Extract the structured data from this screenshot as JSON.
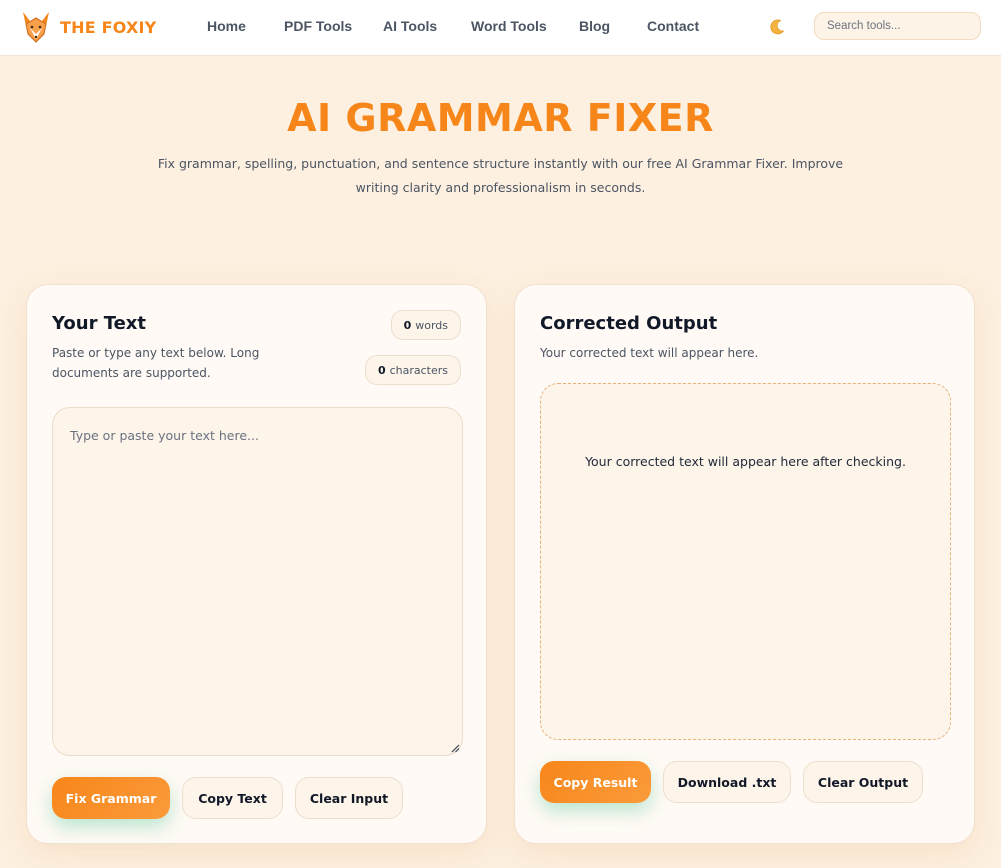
{
  "brand": {
    "name": "THE FOXIY",
    "color": "#f7861a"
  },
  "nav": {
    "items": [
      {
        "label": "Home"
      },
      {
        "label": "PDF Tools"
      },
      {
        "label": "AI Tools"
      },
      {
        "label": "Word Tools"
      },
      {
        "label": "Blog"
      },
      {
        "label": "Contact"
      }
    ],
    "theme_toggle_icon": "moon-icon"
  },
  "search": {
    "placeholder": "Search tools..."
  },
  "hero": {
    "title": "AI GRAMMAR FIXER",
    "subtitle": "Fix grammar, spelling, punctuation, and sentence structure instantly with our free AI Grammar Fixer. Improve writing clarity and professionalism in seconds."
  },
  "input_card": {
    "title": "Your Text",
    "description": "Paste or type any text below. Long documents are supported.",
    "word_count": "0",
    "word_label": "words",
    "char_count": "0",
    "char_label": "characters",
    "textarea_placeholder": "Type or paste your text here...",
    "textarea_value": "",
    "buttons": {
      "fix": "Fix Grammar",
      "copy": "Copy Text",
      "clear": "Clear Input"
    }
  },
  "output_card": {
    "title": "Corrected Output",
    "description": "Your corrected text will appear here.",
    "placeholder": "Your corrected text will appear here after checking.",
    "buttons": {
      "copy": "Copy Result",
      "download": "Download .txt",
      "clear": "Clear Output"
    }
  },
  "colors": {
    "accent": "#f7861a",
    "background": "#fdf0e0",
    "card": "#fffaf5",
    "button_glow": "#84d6b2"
  }
}
